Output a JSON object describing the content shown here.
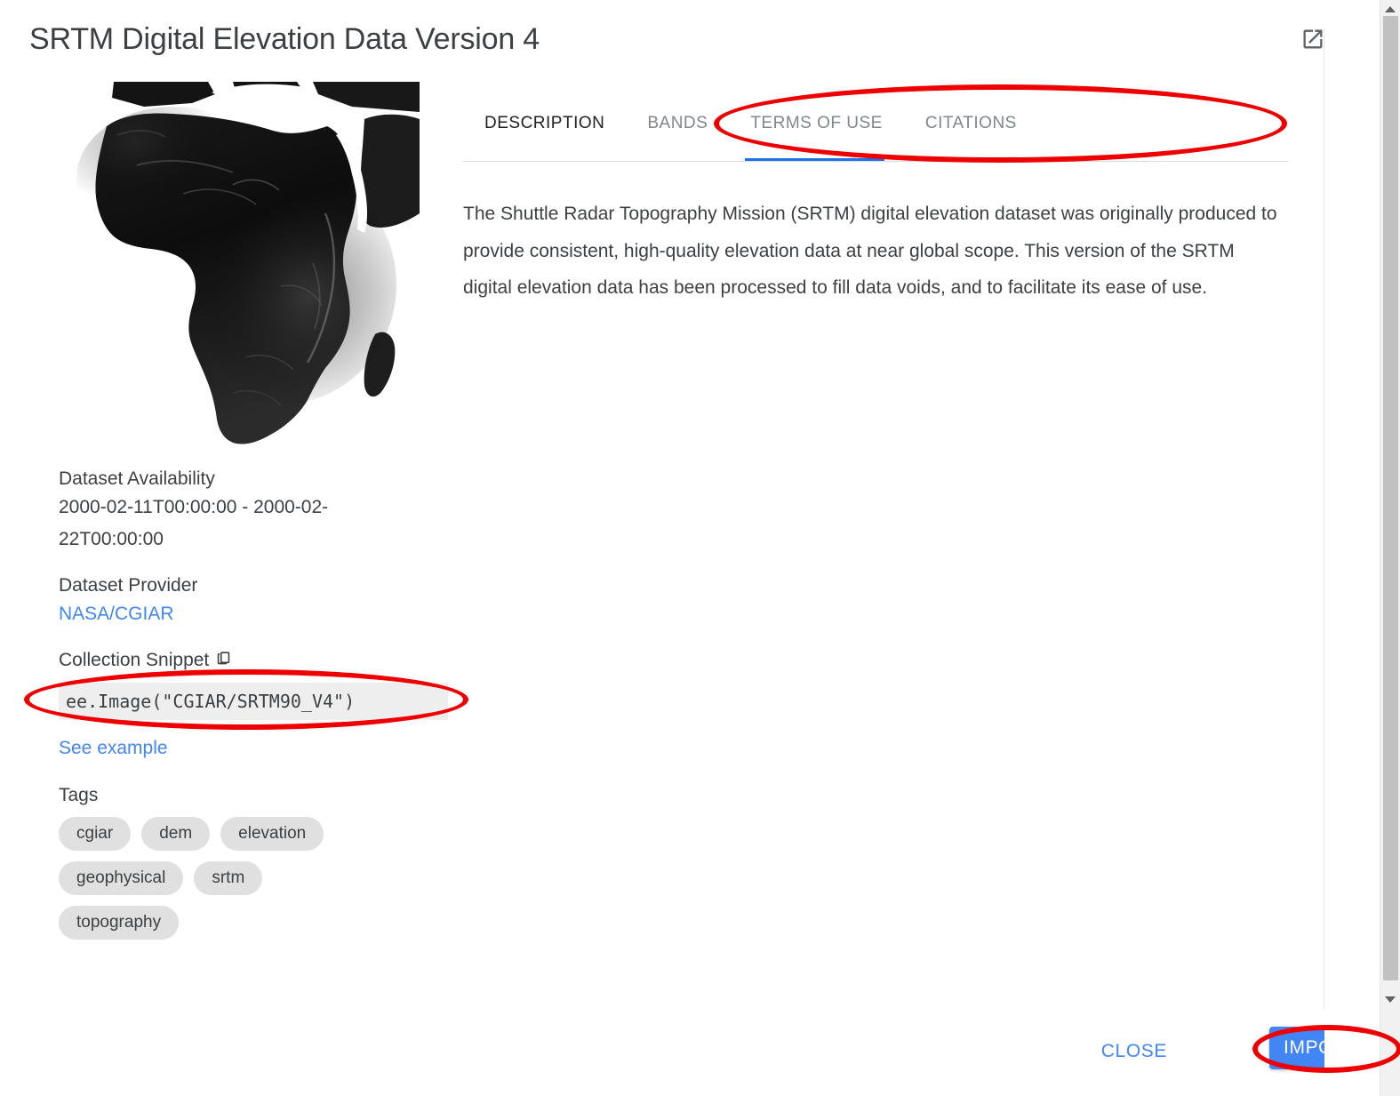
{
  "dialog": {
    "title": "SRTM Digital Elevation Data Version 4",
    "open_new_window_icon": "open-in-new-icon"
  },
  "thumbnail": {
    "alt": "SRTM digital elevation model thumbnail of Africa",
    "icon": "dem-thumbnail"
  },
  "metadata": {
    "availability_label": "Dataset Availability",
    "availability_value": "2000-02-11T00:00:00 - 2000-02-22T00:00:00",
    "provider_label": "Dataset Provider",
    "provider_value": "NASA/CGIAR",
    "snippet_label": "Collection Snippet",
    "copy_icon": "content-copy-icon",
    "snippet_value": "ee.Image(\"CGIAR/SRTM90_V4\")",
    "see_example_label": "See example",
    "tags_label": "Tags",
    "tags": [
      "cgiar",
      "dem",
      "elevation",
      "geophysical",
      "srtm",
      "topography"
    ]
  },
  "tabs": [
    {
      "label": "DESCRIPTION",
      "active": true
    },
    {
      "label": "BANDS",
      "active": false
    },
    {
      "label": "TERMS OF USE",
      "active": false
    },
    {
      "label": "CITATIONS",
      "active": false
    }
  ],
  "description": {
    "body": "The Shuttle Radar Topography Mission (SRTM) digital elevation dataset was originally produced to provide consistent, high-quality elevation data at near global scope. This version of the SRTM digital elevation data has been processed to fill data voids, and to facilitate its ease of use."
  },
  "footer": {
    "close_label": "CLOSE",
    "import_label": "IMPORT"
  },
  "colors": {
    "accent_blue": "#4285f4",
    "tab_indicator": "#1a73e8",
    "annotation_red": "#ee0000",
    "text_primary": "#3c4043",
    "text_muted": "#80868b",
    "chip_bg": "#e0e0e0",
    "snippet_bg": "#eeeeee"
  },
  "annotations": [
    {
      "name": "tabs-highlight",
      "shape": "ellipse"
    },
    {
      "name": "snippet-highlight",
      "shape": "ellipse"
    },
    {
      "name": "import-highlight",
      "shape": "ellipse"
    }
  ]
}
